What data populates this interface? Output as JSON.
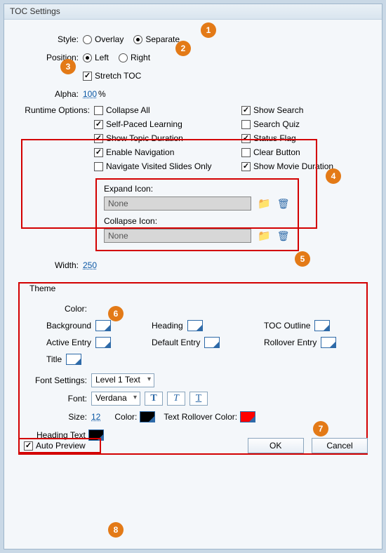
{
  "title": "TOC Settings",
  "style": {
    "label": "Style:",
    "overlay": "Overlay",
    "separate": "Separate"
  },
  "position": {
    "label": "Position:",
    "left": "Left",
    "right": "Right"
  },
  "stretch": "Stretch TOC",
  "alpha": {
    "label": "Alpha:",
    "value": "100",
    "pct": "%"
  },
  "runtime": {
    "label": "Runtime Options:",
    "collapse_all": "Collapse All",
    "show_search": "Show Search",
    "self_paced": "Self-Paced Learning",
    "search_quiz": "Search Quiz",
    "show_topic": "Show Topic Duration",
    "status_flag": "Status Flag",
    "enable_nav": "Enable Navigation",
    "clear_button": "Clear Button",
    "nav_visited": "Navigate Visited Slides Only",
    "show_movie": "Show Movie Duration"
  },
  "expand": {
    "label": "Expand Icon:",
    "value": "None"
  },
  "collapse": {
    "label": "Collapse Icon:",
    "value": "None"
  },
  "width": {
    "label": "Width:",
    "value": "250"
  },
  "theme": {
    "legend": "Theme",
    "color_label": "Color:",
    "background": "Background",
    "heading": "Heading",
    "toc_outline": "TOC Outline",
    "active_entry": "Active Entry",
    "default_entry": "Default Entry",
    "rollover_entry": "Rollover Entry",
    "title": "Title",
    "font_settings": "Font Settings:",
    "level1": "Level 1 Text",
    "font_label": "Font:",
    "font_value": "Verdana",
    "size_label": "Size:",
    "size_value": "12",
    "color2_label": "Color:",
    "text_rollover": "Text Rollover Color:",
    "heading_text": "Heading Text"
  },
  "auto_preview": "Auto Preview",
  "ok": "OK",
  "cancel": "Cancel",
  "badges": {
    "b1": "1",
    "b2": "2",
    "b3": "3",
    "b4": "4",
    "b5": "5",
    "b6": "6",
    "b7": "7",
    "b8": "8"
  }
}
